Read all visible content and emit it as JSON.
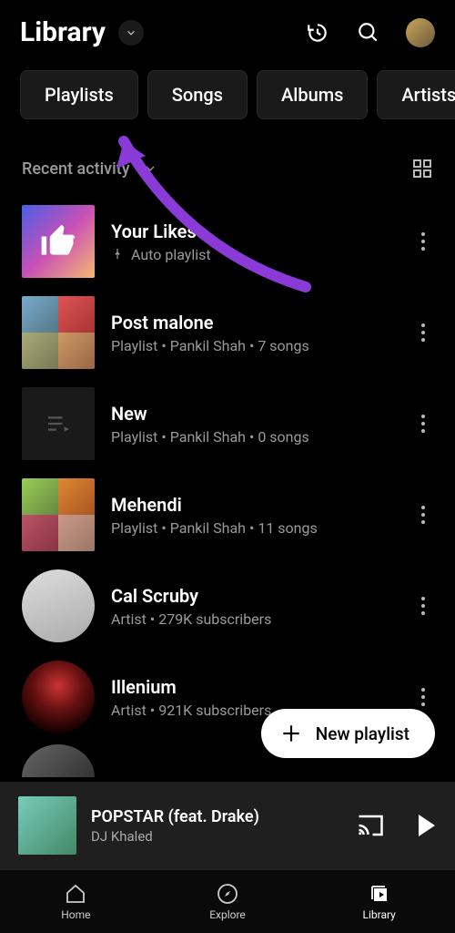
{
  "header": {
    "title": "Library"
  },
  "tabs": [
    "Playlists",
    "Songs",
    "Albums",
    "Artists"
  ],
  "sort": {
    "label": "Recent activity"
  },
  "items": [
    {
      "title": "Your Likes",
      "sub": "Auto playlist",
      "pinned": true,
      "kind": "likes"
    },
    {
      "title": "Post malone",
      "sub": "Playlist • Pankil Shah • 7 songs",
      "kind": "collage"
    },
    {
      "title": "New",
      "sub": "Playlist • Pankil Shah • 0 songs",
      "kind": "empty"
    },
    {
      "title": "Mehendi",
      "sub": "Playlist • Pankil Shah • 11 songs",
      "kind": "collage2"
    },
    {
      "title": "Cal Scruby",
      "sub": "Artist • 279K subscribers",
      "kind": "artist-cal"
    },
    {
      "title": "Illenium",
      "sub": "Artist • 921K subscribers",
      "kind": "artist-ill"
    }
  ],
  "fab": {
    "label": "New playlist"
  },
  "mini": {
    "title": "POPSTAR (feat. Drake)",
    "artist": "DJ Khaled"
  },
  "nav": {
    "home": "Home",
    "explore": "Explore",
    "library": "Library"
  }
}
